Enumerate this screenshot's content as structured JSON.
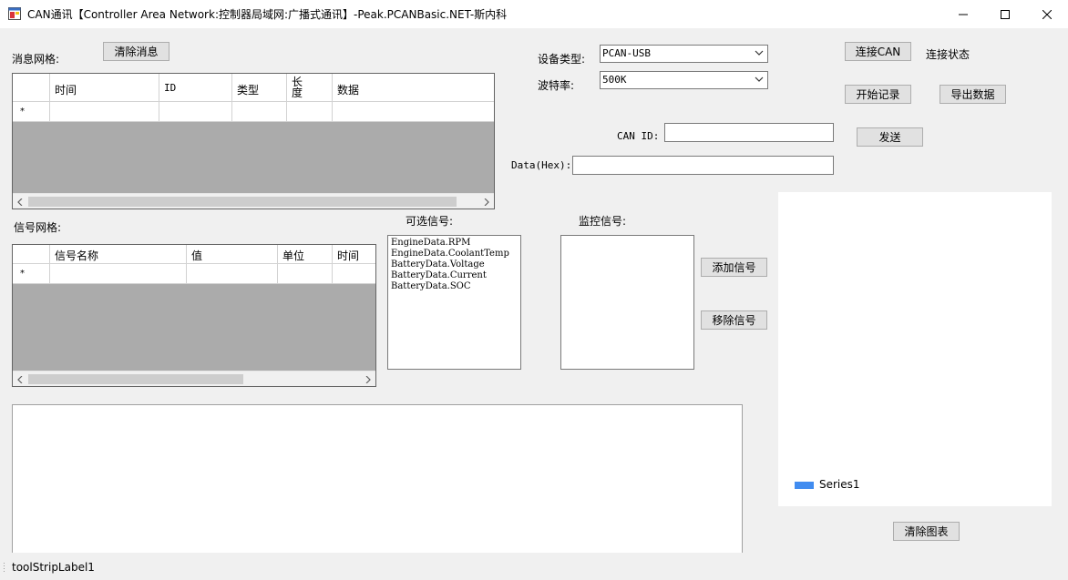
{
  "window": {
    "title": "CAN通讯【Controller Area Network:控制器局域网:广播式通讯】-Peak.PCANBasic.NET-斯内科",
    "minimize_icon": "minimize-icon",
    "maximize_icon": "maximize-icon",
    "close_icon": "close-icon"
  },
  "message_grid": {
    "label": "消息网格:",
    "clear_button": "清除消息",
    "columns": [
      "时间",
      "ID",
      "类型",
      "长度",
      "数据"
    ],
    "new_row_marker": "*"
  },
  "signal_grid": {
    "label": "信号网格:",
    "columns": [
      "信号名称",
      "值",
      "单位",
      "时间"
    ],
    "new_row_marker": "*"
  },
  "device": {
    "type_label": "设备类型:",
    "type_value": "PCAN-USB",
    "baud_label": "波特率:",
    "baud_value": "500K"
  },
  "connection": {
    "connect_button": "连接CAN",
    "status_text": "连接状态",
    "start_record_button": "开始记录",
    "export_button": "导出数据"
  },
  "send": {
    "can_id_label": "CAN ID:",
    "can_id_value": "",
    "data_label": "Data(Hex):",
    "data_value": "",
    "send_button": "发送"
  },
  "signals": {
    "available_label": "可选信号:",
    "available_items": [
      "EngineData.RPM",
      "EngineData.CoolantTemp",
      "BatteryData.Voltage",
      "BatteryData.Current",
      "BatteryData.SOC"
    ],
    "monitored_label": "监控信号:",
    "monitored_items": [],
    "add_button": "添加信号",
    "remove_button": "移除信号"
  },
  "chart": {
    "legend_series": "Series1",
    "series_color": "#418cf0",
    "clear_button": "清除图表"
  },
  "log": {
    "text": ""
  },
  "statusbar": {
    "label": "toolStripLabel1"
  }
}
